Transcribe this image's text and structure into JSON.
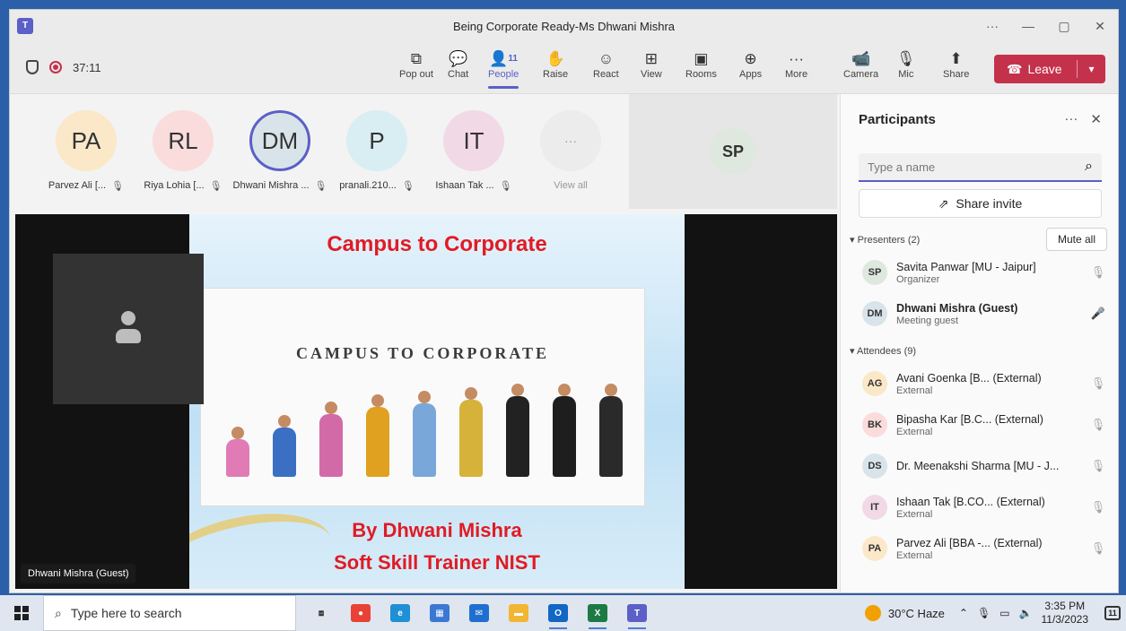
{
  "window": {
    "title": "Being Corporate Ready-Ms Dhwani Mishra",
    "controls": {
      "more": "···",
      "minimize": "—",
      "maximize": "▢",
      "close": "✕"
    }
  },
  "toolbar": {
    "timer": "37:11",
    "buttons": [
      {
        "label": "Pop out",
        "icon": "pop-out-icon",
        "glyph": "⧉"
      },
      {
        "label": "Chat",
        "icon": "chat-icon",
        "glyph": "💬"
      },
      {
        "label": "People",
        "icon": "people-icon",
        "glyph": "👤",
        "badge": "11",
        "active": true
      },
      {
        "label": "Raise",
        "icon": "raise-hand-icon",
        "glyph": "✋"
      },
      {
        "label": "React",
        "icon": "react-icon",
        "glyph": "☺"
      },
      {
        "label": "View",
        "icon": "view-icon",
        "glyph": "⊞"
      },
      {
        "label": "Rooms",
        "icon": "rooms-icon",
        "glyph": "▣"
      },
      {
        "label": "Apps",
        "icon": "apps-icon",
        "glyph": "⊕"
      },
      {
        "label": "More",
        "icon": "more-icon",
        "glyph": "···"
      },
      {
        "label": "Camera",
        "icon": "camera-off-icon",
        "glyph": "📹"
      },
      {
        "label": "Mic",
        "icon": "mic-off-icon",
        "glyph": "🎙"
      },
      {
        "label": "Share",
        "icon": "share-icon",
        "glyph": "⬆"
      }
    ],
    "leave_label": "Leave"
  },
  "gallery": {
    "tiles": [
      {
        "initials": "PA",
        "name": "Parvez Ali [...",
        "color": "#fbe8c8"
      },
      {
        "initials": "RL",
        "name": "Riya Lohia [...",
        "color": "#fbdcdc"
      },
      {
        "initials": "DM",
        "name": "Dhwani Mishra ...",
        "color": "#d9e4ea"
      },
      {
        "initials": "P",
        "name": "pranali.210...",
        "color": "#d9eef2"
      },
      {
        "initials": "IT",
        "name": "Ishaan Tak ...",
        "color": "#f2d9e6"
      },
      {
        "initials": "···",
        "name": "View all",
        "color": "#ececec"
      }
    ],
    "spotlight_initials": "SP"
  },
  "slide": {
    "title": "Campus to Corporate",
    "image_title": "CAMPUS TO CORPORATE",
    "byline": "By Dhwani Mishra",
    "role": "Soft Skill Trainer NIST"
  },
  "presenter_label": "Dhwani Mishra (Guest)",
  "panel": {
    "title": "Participants",
    "more": "···",
    "close": "✕",
    "search_placeholder": "Type a name",
    "share_invite": "Share invite",
    "presenters_header": "Presenters (2)",
    "mute_all": "Mute all",
    "attendees_header": "Attendees (9)",
    "presenters": [
      {
        "initials": "SP",
        "name": "Savita Panwar [MU - Jaipur]",
        "role": "Organizer",
        "color": "#dfe8de",
        "mic": "off"
      },
      {
        "initials": "DM",
        "name": "Dhwani Mishra (Guest)",
        "role": "Meeting guest",
        "color": "#d9e4ea",
        "mic": "on",
        "bold": true
      }
    ],
    "attendees": [
      {
        "initials": "AG",
        "name": "Avani Goenka [B... (External)",
        "role": "External",
        "color": "#fbe8c8"
      },
      {
        "initials": "BK",
        "name": "Bipasha Kar [B.C... (External)",
        "role": "External",
        "color": "#fbdcdc"
      },
      {
        "initials": "DS",
        "name": "Dr. Meenakshi Sharma [MU - J...",
        "role": "",
        "color": "#d9e4ea"
      },
      {
        "initials": "IT",
        "name": "Ishaan Tak [B.CO... (External)",
        "role": "External",
        "color": "#f2d9e6"
      },
      {
        "initials": "PA",
        "name": "Parvez Ali [BBA -... (External)",
        "role": "External",
        "color": "#fbe8c8"
      }
    ]
  },
  "taskbar": {
    "search_placeholder": "Type here to search",
    "apps": [
      {
        "name": "task-view",
        "glyph": "⧈",
        "color": "#dfe6ef"
      },
      {
        "name": "chrome",
        "glyph": "●",
        "color": "#e94235"
      },
      {
        "name": "edge",
        "glyph": "e",
        "color": "#1f8fd6"
      },
      {
        "name": "store",
        "glyph": "▦",
        "color": "#3a78d4"
      },
      {
        "name": "mail",
        "glyph": "✉",
        "color": "#1f6fd0"
      },
      {
        "name": "explorer",
        "glyph": "▬",
        "color": "#f2b632"
      },
      {
        "name": "outlook",
        "glyph": "O",
        "color": "#1266c4"
      },
      {
        "name": "excel",
        "glyph": "X",
        "color": "#1d7a45"
      },
      {
        "name": "teams",
        "glyph": "T",
        "color": "#5b5fc7"
      }
    ],
    "weather": "30°C Haze",
    "time": "3:35 PM",
    "date": "11/3/2023",
    "notifications": "11"
  }
}
